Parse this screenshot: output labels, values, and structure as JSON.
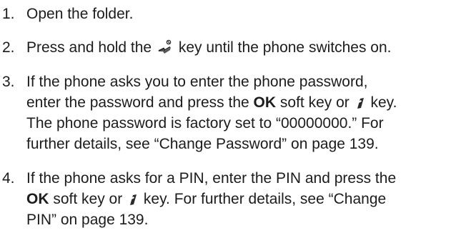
{
  "steps": [
    {
      "number": "1.",
      "lines": [
        {
          "t1": "Open the folder."
        }
      ]
    },
    {
      "number": "2.",
      "lines": [
        {
          "t1": "Press and hold the",
          "icon": "end-power-key-icon",
          "t2": "key until the phone switches on."
        }
      ]
    },
    {
      "number": "3.",
      "lines": [
        {
          "t1": "If the phone asks you to enter the phone password,"
        },
        {
          "t1": "enter the password and press the",
          "bold": "OK",
          "t2": "soft key or",
          "icon": "ok-key-icon",
          "t3": "key."
        },
        {
          "t1": "The phone password is factory set to “00000000.” For"
        },
        {
          "t1": "further details, see “Change Password” on page 139."
        }
      ]
    },
    {
      "number": "4.",
      "lines": [
        {
          "t1": "If the phone asks for a PIN, enter the PIN and press the"
        },
        {
          "bold": "OK",
          "t2": "soft key or",
          "icon": "ok-key-icon",
          "t3": "key. For further details, see “Change"
        },
        {
          "t1": "PIN” on page 139."
        }
      ]
    }
  ]
}
